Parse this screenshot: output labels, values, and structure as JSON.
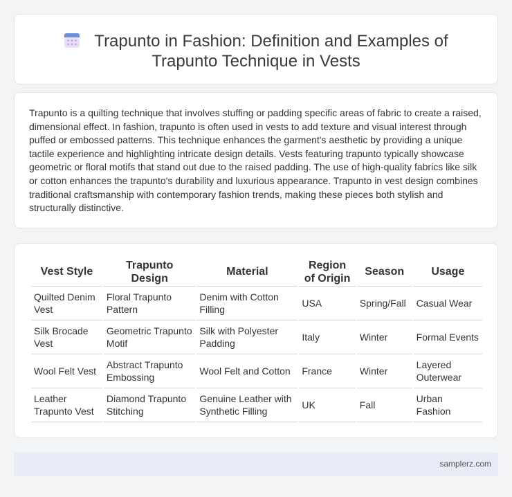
{
  "header": {
    "title_line1": "Trapunto in Fashion: Definition and Examples of",
    "title_line2": "Trapunto Technique in Vests",
    "icon": "calendar-icon",
    "icon_colors": [
      "#6f8fe0",
      "#c9b4ee",
      "#e8dff8"
    ]
  },
  "intro": {
    "text": "Trapunto is a quilting technique that involves stuffing or padding specific areas of fabric to create a raised, dimensional effect. In fashion, trapunto is often used in vests to add texture and visual interest through puffed or embossed patterns. This technique enhances the garment's aesthetic by providing a unique tactile experience and highlighting intricate design details. Vests featuring trapunto typically showcase geometric or floral motifs that stand out due to the raised padding. The use of high-quality fabrics like silk or cotton enhances the trapunto's durability and luxurious appearance. Trapunto in vest design combines traditional craftsmanship with contemporary fashion trends, making these pieces both stylish and structurally distinctive."
  },
  "table": {
    "headers": [
      "Vest Style",
      "Trapunto Design",
      "Material",
      "Region of Origin",
      "Season",
      "Usage"
    ],
    "rows": [
      [
        "Quilted Denim Vest",
        "Floral Trapunto Pattern",
        "Denim with Cotton Filling",
        "USA",
        "Spring/Fall",
        "Casual Wear"
      ],
      [
        "Silk Brocade Vest",
        "Geometric Trapunto Motif",
        "Silk with Polyester Padding",
        "Italy",
        "Winter",
        "Formal Events"
      ],
      [
        "Wool Felt Vest",
        "Abstract Trapunto Embossing",
        "Wool Felt and Cotton",
        "France",
        "Winter",
        "Layered Outerwear"
      ],
      [
        "Leather Trapunto Vest",
        "Diamond Trapunto Stitching",
        "Genuine Leather with Synthetic Filling",
        "UK",
        "Fall",
        "Urban Fashion"
      ]
    ]
  },
  "footer": {
    "text": "samplerz.com"
  }
}
